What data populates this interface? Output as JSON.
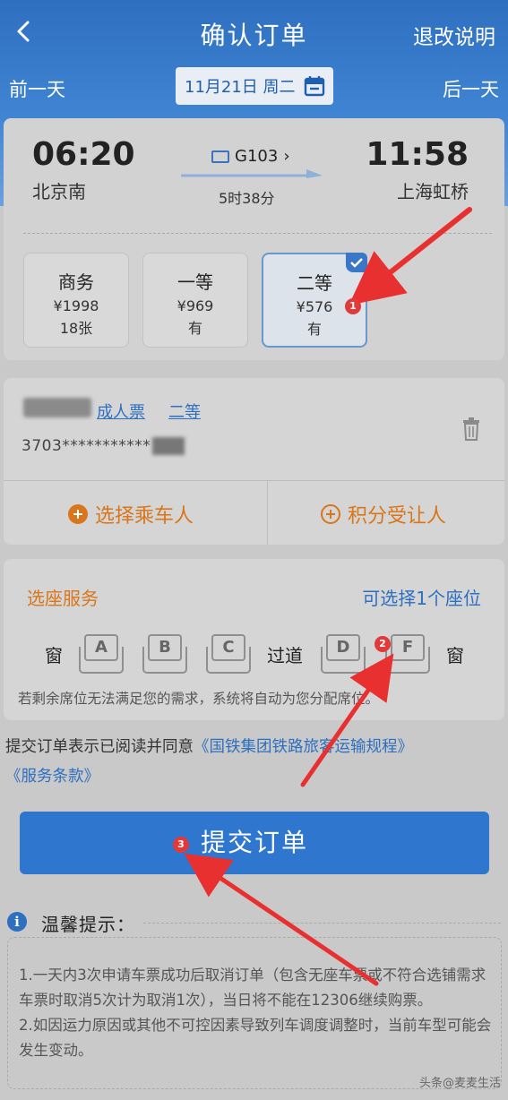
{
  "nav": {
    "title": "确认订单",
    "right_link": "退改说明"
  },
  "date_bar": {
    "prev_day": "前一天",
    "date": "11月21日 周二",
    "next_day": "后一天"
  },
  "train": {
    "departure_time": "06:20",
    "departure_station": "北京南",
    "train_number": "G103",
    "duration": "5时38分",
    "arrival_time": "11:58",
    "arrival_station": "上海虹桥"
  },
  "seat_classes": [
    {
      "name": "商务",
      "price": "¥1998",
      "availability": "18张",
      "selected": false
    },
    {
      "name": "一等",
      "price": "¥969",
      "availability": "有",
      "selected": false
    },
    {
      "name": "二等",
      "price": "¥576",
      "availability": "有",
      "selected": true
    }
  ],
  "passenger": {
    "name_visible": "",
    "ticket_type": "成人票",
    "seat_class": "二等",
    "id_number": "3703***********"
  },
  "passenger_actions": {
    "select_passenger": "选择乘车人",
    "points_beneficiary": "积分受让人"
  },
  "seat_service": {
    "title": "选座服务",
    "limit": "可选择1个座位",
    "window_left": "窗",
    "aisle": "过道",
    "window_right": "窗",
    "seats": [
      "A",
      "B",
      "C",
      "D",
      "F"
    ],
    "note": "若剩余席位无法满足您的需求，系统将自动为您分配席位。"
  },
  "agreement": {
    "prefix": "提交订单表示已阅读并同意",
    "link1": "《国铁集团铁路旅客运输规程》",
    "link2": "《服务条款》"
  },
  "submit_label": "提交订单",
  "tips": {
    "icon_letter": "i",
    "title": "温馨提示：",
    "item1": "1.一天内3次申请车票成功后取消订单（包含无座车票或不符合选铺需求车票时取消5次计为取消1次），当日将不能在12306继续购票。",
    "item2": "2.如因运力原因或其他不可控因素导致列车调度调整时，当前车型可能会发生变动。"
  },
  "watermark": "头条@麦麦生活",
  "annotations": {
    "badge1": "1",
    "badge2": "2",
    "badge3": "3"
  },
  "colors": {
    "primary": "#2f76cf",
    "accent": "#d9751a",
    "annotation": "#e03a3a"
  }
}
